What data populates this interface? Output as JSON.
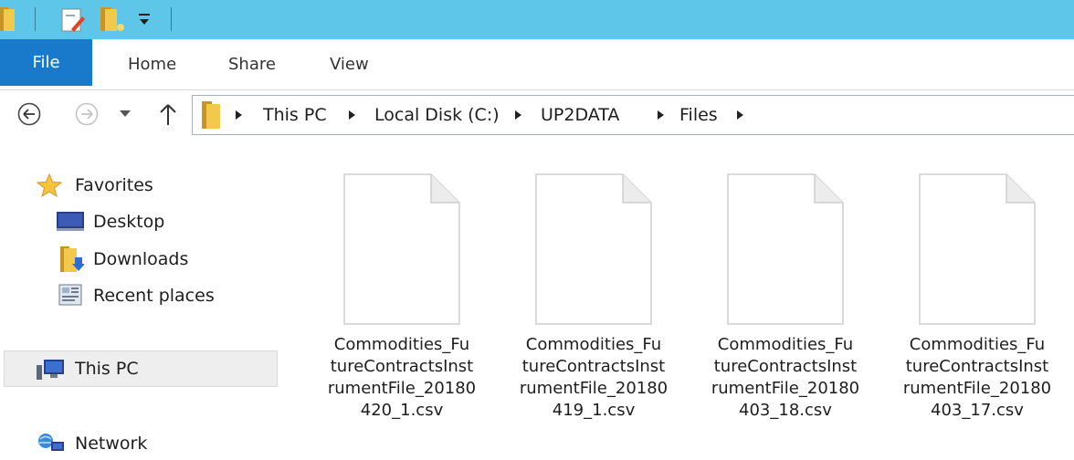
{
  "ribbon": {
    "tabs": [
      {
        "label": "File"
      },
      {
        "label": "Home"
      },
      {
        "label": "Share"
      },
      {
        "label": "View"
      }
    ]
  },
  "breadcrumb": {
    "items": [
      "This PC",
      "Local Disk (C:)",
      "UP2DATA",
      "Files"
    ]
  },
  "nav_pane": {
    "favorites": "Favorites",
    "desktop": "Desktop",
    "downloads": "Downloads",
    "recent_places": "Recent places",
    "this_pc": "This PC",
    "network": "Network"
  },
  "files": [
    {
      "lines": [
        "Commodities_Fu",
        "tureContractsInst",
        "rumentFile_20180",
        "420_1.csv"
      ]
    },
    {
      "lines": [
        "Commodities_Fu",
        "tureContractsInst",
        "rumentFile_20180",
        "419_1.csv"
      ]
    },
    {
      "lines": [
        "Commodities_Fu",
        "tureContractsInst",
        "rumentFile_20180",
        "403_18.csv"
      ]
    },
    {
      "lines": [
        "Commodities_Fu",
        "tureContractsInst",
        "rumentFile_20180",
        "403_17.csv"
      ]
    }
  ],
  "colors": {
    "titlebar": "#5ec6e8",
    "file_tab": "#1979ca",
    "selected_item": "#eeeeee"
  },
  "icons": {
    "qat": [
      "folder-icon",
      "properties-icon",
      "new-folder-icon",
      "customize-qat-icon"
    ],
    "nav": [
      "back-icon",
      "forward-icon",
      "recent-locations-icon",
      "up-icon"
    ],
    "tree": [
      "star-icon",
      "desktop-icon",
      "downloads-icon",
      "recent-places-icon",
      "computer-icon",
      "network-icon"
    ],
    "file": "csv-file-icon"
  }
}
